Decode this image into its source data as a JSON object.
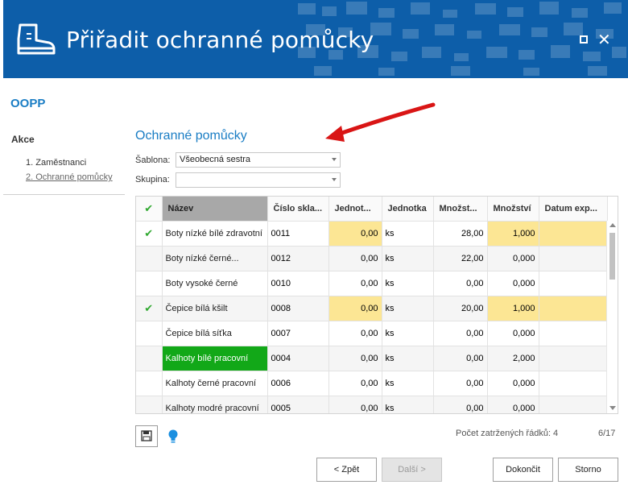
{
  "window": {
    "title": "Přiřadit ochranné pomůcky",
    "header_color": "#0d5ea9"
  },
  "sidebar": {
    "app_name": "OOPP",
    "section_title": "Akce",
    "steps": [
      {
        "label": "1. Zaměstnanci"
      },
      {
        "label": "2. Ochranné pomůcky",
        "active": true
      }
    ]
  },
  "main": {
    "section_title": "Ochranné pomůcky",
    "fields": {
      "sablona_label": "Šablona:",
      "sablona_value": "Všeobecná sestra",
      "skupina_label": "Skupina:",
      "skupina_value": ""
    }
  },
  "grid": {
    "check_header": "✔",
    "columns": [
      "Název",
      "Číslo skla...",
      "Jednot...",
      "Jednotka",
      "Množst...",
      "Množství",
      "Datum exp..."
    ],
    "rows": [
      {
        "checked": true,
        "name": "Boty nízké bílé zdravotní",
        "cislo": "0011",
        "jednot": "0,00",
        "jednotka": "ks",
        "mnozst": "28,00",
        "mnozstvi": "1,000",
        "datum": ""
      },
      {
        "checked": false,
        "name": "Boty nízké černé...",
        "cislo": "0012",
        "jednot": "0,00",
        "jednotka": "ks",
        "mnozst": "22,00",
        "mnozstvi": "0,000",
        "datum": ""
      },
      {
        "checked": false,
        "name": "Boty vysoké černé",
        "cislo": "0010",
        "jednot": "0,00",
        "jednotka": "ks",
        "mnozst": "0,00",
        "mnozstvi": "0,000",
        "datum": ""
      },
      {
        "checked": true,
        "name": "Čepice bílá kšilt",
        "cislo": "0008",
        "jednot": "0,00",
        "jednotka": "ks",
        "mnozst": "20,00",
        "mnozstvi": "1,000",
        "datum": ""
      },
      {
        "checked": false,
        "name": "Čepice bílá síťka",
        "cislo": "0007",
        "jednot": "0,00",
        "jednotka": "ks",
        "mnozst": "0,00",
        "mnozstvi": "0,000",
        "datum": ""
      },
      {
        "checked": false,
        "name": "Kalhoty bílé pracovní",
        "cislo": "0004",
        "jednot": "0,00",
        "jednotka": "ks",
        "mnozst": "0,00",
        "mnozstvi": "2,000",
        "datum": ""
      },
      {
        "checked": false,
        "name": "Kalhoty černé pracovní",
        "cislo": "0006",
        "jednot": "0,00",
        "jednotka": "ks",
        "mnozst": "0,00",
        "mnozstvi": "0,000",
        "datum": ""
      },
      {
        "checked": false,
        "name": "Kalhoty modré pracovní",
        "cislo": "0005",
        "jednot": "0,00",
        "jednotka": "ks",
        "mnozst": "0,00",
        "mnozstvi": "0,000",
        "datum": ""
      }
    ],
    "highlight_color": "#fce694",
    "selected_color": "#12a818"
  },
  "footer": {
    "row_count": "Počet zatržených řádků: 4",
    "page_count": "6/17",
    "back_label": "< Zpět",
    "next_label": "Další >",
    "finish_label": "Dokončit",
    "cancel_label": "Storno"
  },
  "icons": {
    "header": "boot-icon",
    "save": "floppy-disk-icon",
    "hint": "lightbulb-icon",
    "annotation": "red-arrow-icon"
  }
}
